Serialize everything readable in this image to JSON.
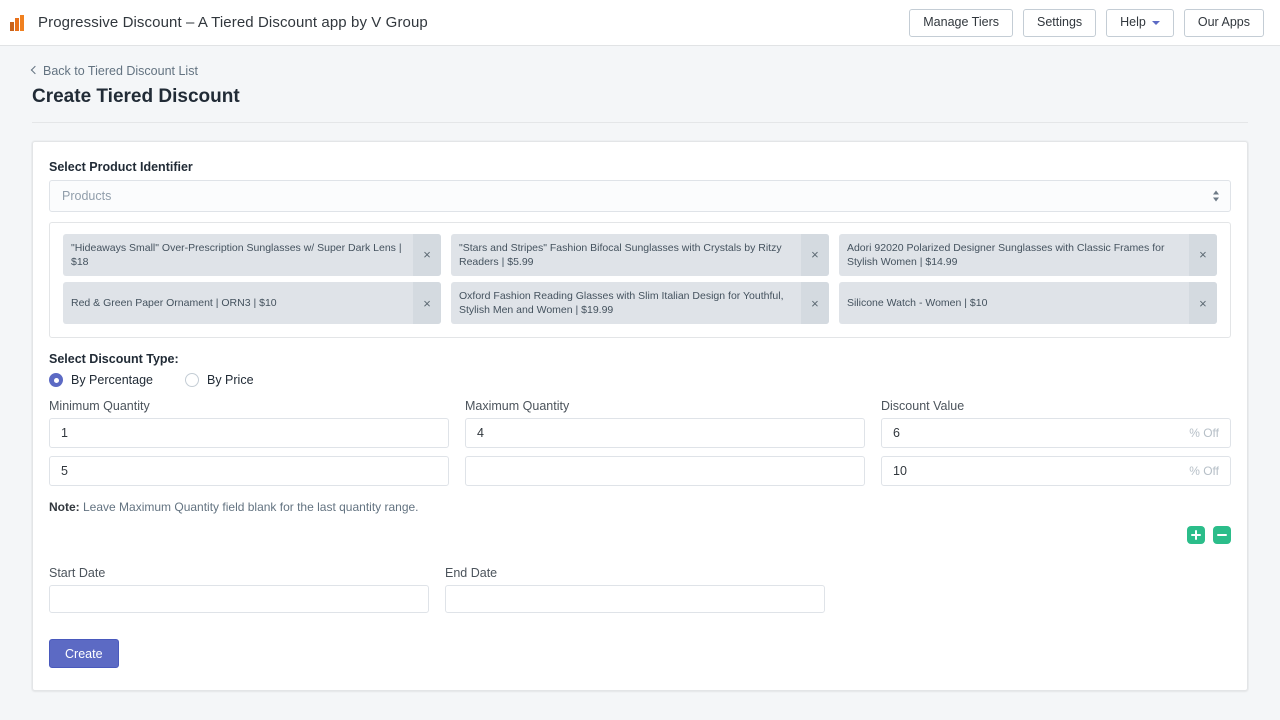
{
  "topbar": {
    "logo_icon": "bar-chart-logo-icon",
    "title": "Progressive Discount – A Tiered Discount app by V Group",
    "buttons": [
      {
        "label": "Manage Tiers",
        "has_caret": false
      },
      {
        "label": "Settings",
        "has_caret": false
      },
      {
        "label": "Help",
        "has_caret": true
      },
      {
        "label": "Our Apps",
        "has_caret": false
      }
    ]
  },
  "page": {
    "back_link": "Back to Tiered Discount List",
    "title": "Create Tiered Discount"
  },
  "form": {
    "product_identifier_label": "Select Product Identifier",
    "product_select_placeholder": "Products",
    "selected_products": [
      "\"Hideaways Small\" Over-Prescription Sunglasses w/ Super Dark Lens | $18",
      "\"Stars and Stripes\" Fashion Bifocal Sunglasses with Crystals by Ritzy Readers | $5.99",
      "Adori 92020 Polarized Designer Sunglasses with Classic Frames for Stylish Women | $14.99",
      "Red & Green Paper Ornament | ORN3 | $10",
      "Oxford Fashion Reading Glasses with Slim Italian Design for Youthful, Stylish Men and Women | $19.99",
      "Silicone Watch - Women | $10"
    ],
    "remove_tag_label": "×",
    "discount_type_label": "Select Discount Type:",
    "discount_types": [
      {
        "label": "By Percentage",
        "selected": true
      },
      {
        "label": "By Price",
        "selected": false
      }
    ],
    "min_quantity_label": "Minimum Quantity",
    "max_quantity_label": "Maximum Quantity",
    "discount_value_label": "Discount Value",
    "tiers": [
      {
        "min": "1",
        "max": "4",
        "value": "6",
        "suffix": "% Off"
      },
      {
        "min": "5",
        "max": "",
        "value": "10",
        "suffix": "% Off"
      }
    ],
    "note_prefix": "Note:",
    "note_text": " Leave Maximum Quantity field blank for the last quantity range.",
    "add_row_icon": "plus-icon",
    "remove_row_icon": "minus-icon",
    "start_date_label": "Start Date",
    "end_date_label": "End Date",
    "start_date_value": "",
    "end_date_value": "",
    "submit_label": "Create"
  },
  "colors": {
    "accent": "#5c6ac4",
    "brand": "#e8701a",
    "success": "#2bbd8a",
    "page_bg": "#f4f6f8",
    "tag_bg": "#dfe3e8"
  }
}
